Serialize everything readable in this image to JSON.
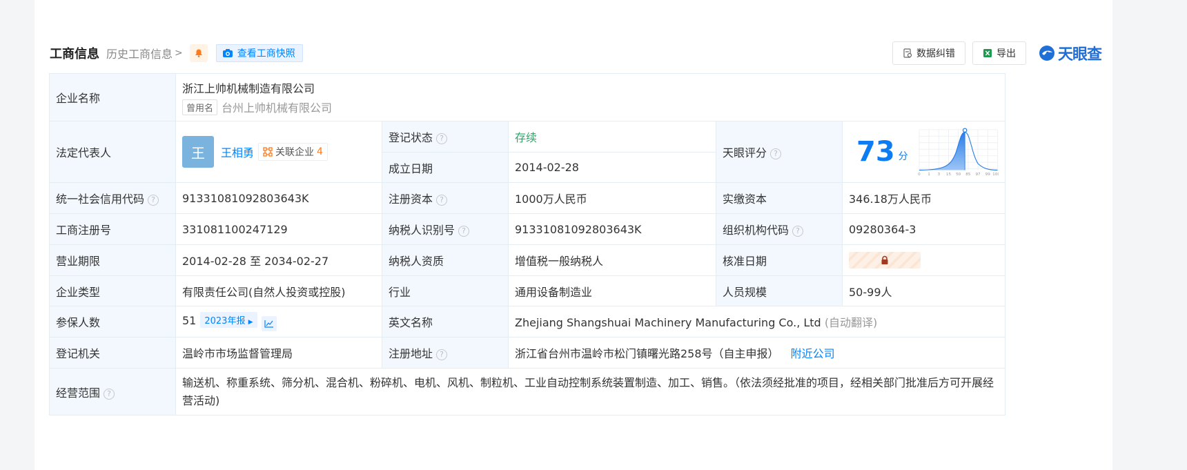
{
  "header": {
    "title": "工商信息",
    "history_link": "历史工商信息",
    "snapshot_button": "查看工商快照",
    "correct_button": "数据纠错",
    "export_button": "导出",
    "logo_text": "天眼查"
  },
  "company": {
    "name_label": "企业名称",
    "name": "浙江上帅机械制造有限公司",
    "used_name_tag": "曾用名",
    "used_name": "台州上帅机械有限公司"
  },
  "legal_rep": {
    "label": "法定代表人",
    "avatar_char": "王",
    "name": "王相勇",
    "related_label": "关联企业",
    "related_count": "4"
  },
  "status": {
    "label": "登记状态",
    "value": "存续"
  },
  "founded": {
    "label": "成立日期",
    "value": "2014-02-28"
  },
  "score": {
    "label": "天眼评分",
    "value": "73",
    "unit": "分",
    "axis_ticks": [
      "0",
      "1",
      "3",
      "15",
      "50",
      "85",
      "97",
      "99",
      "100"
    ]
  },
  "credit_code": {
    "label": "统一社会信用代码",
    "value": "91331081092803643K"
  },
  "reg_capital": {
    "label": "注册资本",
    "value": "1000万人民币"
  },
  "paid_capital": {
    "label": "实缴资本",
    "value": "346.18万人民币"
  },
  "reg_no": {
    "label": "工商注册号",
    "value": "331081100247129"
  },
  "taxpayer_id": {
    "label": "纳税人识别号",
    "value": "91331081092803643K"
  },
  "org_code": {
    "label": "组织机构代码",
    "value": "09280364-3"
  },
  "term": {
    "label": "营业期限",
    "value": "2014-02-28 至 2034-02-27"
  },
  "taxpayer_type": {
    "label": "纳税人资质",
    "value": "增值税一般纳税人"
  },
  "approve_date": {
    "label": "核准日期"
  },
  "company_type": {
    "label": "企业类型",
    "value": "有限责任公司(自然人投资或控股)"
  },
  "industry": {
    "label": "行业",
    "value": "通用设备制造业"
  },
  "staff_size": {
    "label": "人员规模",
    "value": "50-99人"
  },
  "insured": {
    "label": "参保人数",
    "value": "51",
    "year_button": "2023年报"
  },
  "english_name": {
    "label": "英文名称",
    "value": "Zhejiang Shangshuai Machinery Manufacturing Co., Ltd",
    "note": "(自动翻译)"
  },
  "authority": {
    "label": "登记机关",
    "value": "温岭市市场监督管理局"
  },
  "address": {
    "label": "注册地址",
    "value": "浙江省台州市温岭市松门镇曙光路258号（自主申报）",
    "nearby": "附近公司"
  },
  "scope": {
    "label": "经营范围",
    "value": "输送机、称重系统、筛分机、混合机、粉碎机、电机、风机、制粒机、工业自动控制系统装置制造、加工、销售。（依法须经批准的项目，经相关部门批准后方可开展经营活动)"
  },
  "colors": {
    "accent": "#0084ff",
    "status_green": "#2aa868",
    "label_bg": "#f2f8fe",
    "border": "#e4ecf4",
    "score_blue": "#0d7cf2"
  }
}
